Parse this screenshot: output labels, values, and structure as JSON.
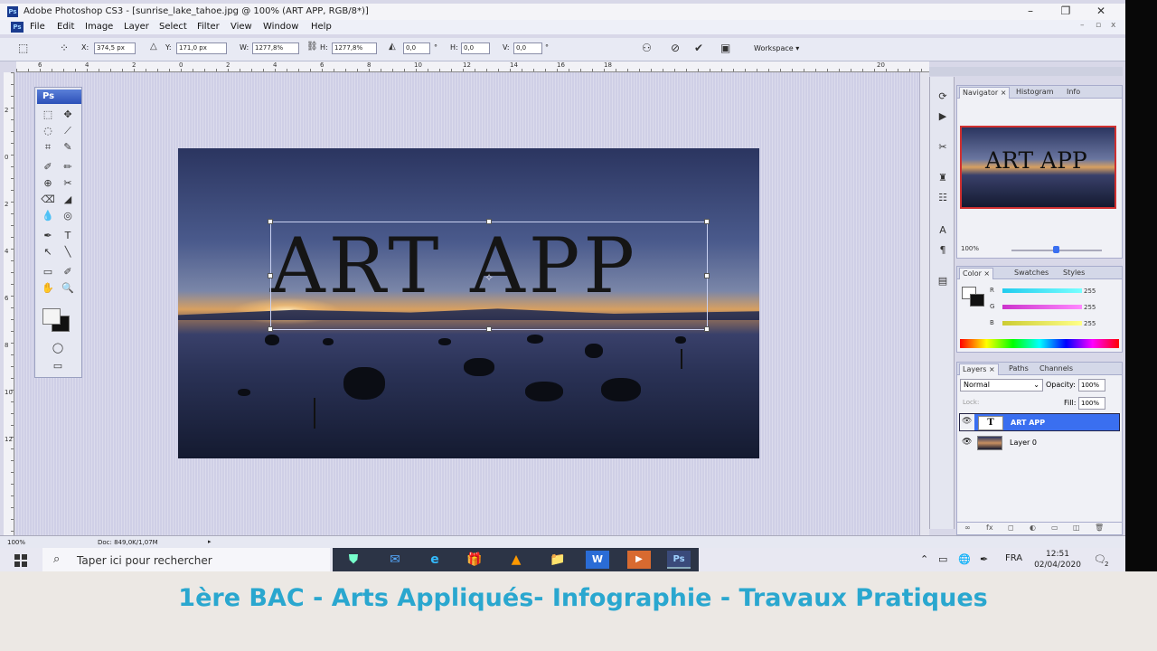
{
  "window": {
    "title": "Adobe Photoshop CS3 - [sunrise_lake_tahoe.jpg @ 100% (ART APP, RGB/8*)]",
    "app_icon": "Ps",
    "controls": [
      "–",
      "❐",
      "✕"
    ],
    "doc_controls": [
      "–",
      "▫",
      "x"
    ]
  },
  "menu": {
    "items": [
      "File",
      "Edit",
      "Image",
      "Layer",
      "Select",
      "Filter",
      "View",
      "Window",
      "Help"
    ]
  },
  "options": {
    "x_label": "X:",
    "x_value": "374,5 px",
    "y_label": "Y:",
    "y_value": "171,0 px",
    "w_label": "W:",
    "w_value": "1277,8%",
    "h_label": "H:",
    "h_value": "1277,8%",
    "angle_value": "0,0",
    "deg1": "°",
    "hskew_label": "H:",
    "hskew_value": "0,0",
    "vskew_label": "V:",
    "vskew_value": "0,0",
    "deg2": "°",
    "workspace": "Workspace ▾"
  },
  "rulers": {
    "h": [
      "6",
      "4",
      "2",
      "0",
      "2",
      "4",
      "6",
      "8",
      "10",
      "12",
      "14",
      "16",
      "18",
      "20"
    ],
    "v": [
      "2",
      "0",
      "2",
      "4",
      "6",
      "8",
      "10",
      "12"
    ]
  },
  "canvas": {
    "text_layer": "ART APP"
  },
  "toolbox": {
    "logo": "Ps",
    "tools": [
      "⬚",
      "✥",
      "◌",
      "⟋",
      "⌗",
      "✎",
      "✐",
      "✏",
      "⊕",
      "✂",
      "⌫",
      "◢",
      "💧",
      "◎",
      "✒",
      "T",
      "↖",
      "╲",
      "▭",
      "✐",
      "✋",
      "🔍"
    ],
    "mask": "◯",
    "screen": "▭"
  },
  "iconstrip": [
    "⟳",
    "▶",
    "✂",
    "♜",
    "☷",
    "A",
    "¶",
    "▤"
  ],
  "navigator": {
    "tabs": [
      "Navigator ×",
      "Histogram",
      "Info"
    ],
    "zoom": "100%"
  },
  "color": {
    "tabs": [
      "Color ×",
      "Swatches",
      "Styles"
    ],
    "channels": [
      {
        "label": "R",
        "value": "255",
        "color": "#20d0e0"
      },
      {
        "label": "G",
        "value": "255",
        "color": "#d030d0"
      },
      {
        "label": "B",
        "value": "255",
        "color": "#d0d030"
      }
    ]
  },
  "layers": {
    "tabs": [
      "Layers ×",
      "Paths",
      "Channels"
    ],
    "blend_mode": "Normal",
    "opacity_label": "Opacity:",
    "opacity": "100%",
    "lock_label": "Lock:",
    "fill_label": "Fill:",
    "fill": "100%",
    "rows": [
      {
        "name": "ART APP",
        "selected": true
      },
      {
        "name": "Layer 0",
        "selected": false
      }
    ],
    "footer_icons": [
      "∞",
      "fx",
      "◻",
      "◐",
      "▭",
      "◫",
      "🗑"
    ]
  },
  "status": {
    "zoom": "100%",
    "doc": "Doc: 849,0K/1,07M"
  },
  "taskbar": {
    "search": "Taper ici pour rechercher",
    "apps": [
      "⛊",
      "✉",
      "e",
      "🎁",
      "▲",
      "📁",
      "W",
      "▶",
      "Ps"
    ],
    "language": "FRA",
    "time": "12:51",
    "date": "02/04/2020",
    "notifications": "2"
  },
  "caption": "1ère BAC - Arts Appliqués- Infographie - Travaux Pratiques",
  "colors": {
    "accent": "#2aa7cf",
    "selection": "#3a6ff0"
  }
}
